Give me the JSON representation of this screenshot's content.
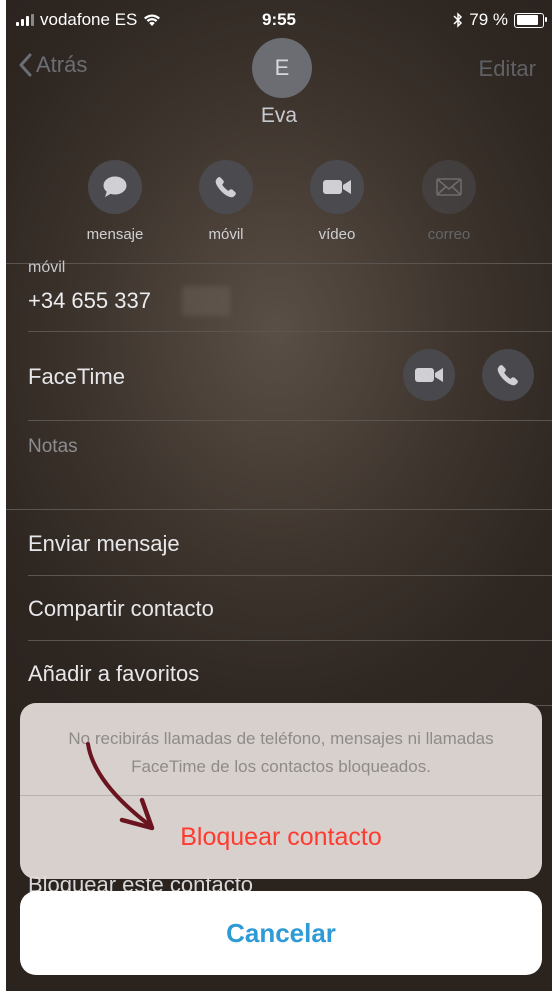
{
  "status_bar": {
    "carrier": "vodafone ES",
    "time": "9:55",
    "battery": "79 %"
  },
  "nav": {
    "back_label": "Atrás",
    "edit_label": "Editar"
  },
  "contact": {
    "initial": "E",
    "name": "Eva"
  },
  "actions": [
    {
      "label": "mensaje",
      "icon": "message-icon",
      "enabled": true
    },
    {
      "label": "móvil",
      "icon": "phone-icon",
      "enabled": true
    },
    {
      "label": "vídeo",
      "icon": "video-icon",
      "enabled": true
    },
    {
      "label": "correo",
      "icon": "mail-icon",
      "enabled": false
    }
  ],
  "phone": {
    "label": "móvil",
    "number": "+34 655 337"
  },
  "facetime": {
    "label": "FaceTime"
  },
  "notes": {
    "label": "Notas"
  },
  "list": {
    "send_message": "Enviar mensaje",
    "share_contact": "Compartir contacto",
    "add_favorites": "Añadir a favoritos",
    "block_contact_behind": "Bloquear este contacto"
  },
  "action_sheet": {
    "message": "No recibirás llamadas de teléfono, mensajes ni llamadas FaceTime de los contactos bloqueados.",
    "block_label": "Bloquear contacto",
    "cancel_label": "Cancelar"
  },
  "colors": {
    "destructive": "#ff3b30",
    "cancel": "#2e9ad6",
    "annotation_arrow": "#6a1420"
  }
}
